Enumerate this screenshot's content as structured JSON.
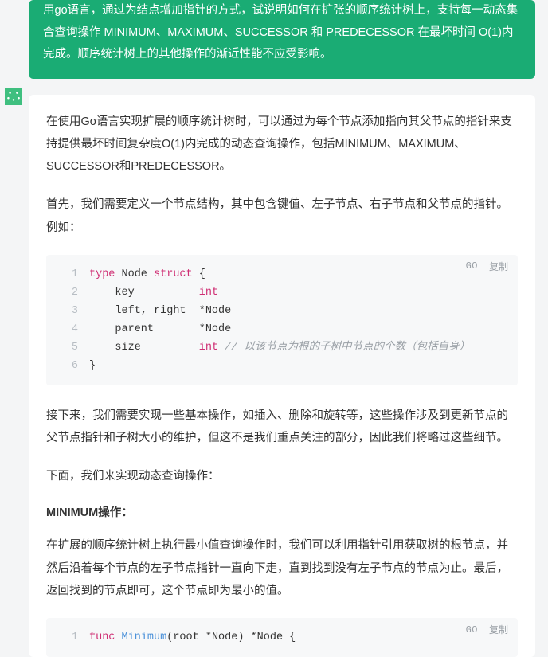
{
  "prompt": {
    "text": "用go语言，通过为结点增加指针的方式，试说明如何在扩张的顺序统计树上，支持每一动态集合查询操作 MINIMUM、MAXIMUM、SUCCESSOR 和 PREDECESSOR 在最坏时间 O(1)内完成。顺序统计树上的其他操作的渐近性能不应受影响。"
  },
  "avatar": {
    "name": "assistant-avatar"
  },
  "paras": {
    "p1": "在使用Go语言实现扩展的顺序统计树时，可以通过为每个节点添加指向其父节点的指针来支持提供最坏时间复杂度O(1)内完成的动态查询操作，包括MINIMUM、MAXIMUM、SUCCESSOR和PREDECESSOR。",
    "p2": "首先，我们需要定义一个节点结构，其中包含键值、左子节点、右子节点和父节点的指针。例如：",
    "p3": "接下来，我们需要实现一些基本操作，如插入、删除和旋转等，这些操作涉及到更新节点的父节点指针和子树大小的维护，但这不是我们重点关注的部分，因此我们将略过这些细节。",
    "p4": "下面，我们来实现动态查询操作：",
    "p5": "在扩展的顺序统计树上执行最小值查询操作时，我们可以利用指针引用获取树的根节点，并然后沿着每个节点的左子节点指针一直向下走，直到找到没有左子节点的节点为止。最后，返回找到的节点即可，这个节点即为最小的值。"
  },
  "heading1": "MINIMUM操作：",
  "codeA": {
    "lang": "GO",
    "copy": "复制",
    "lines": {
      "n1": "1",
      "n2": "2",
      "n3": "3",
      "n4": "4",
      "n5": "5",
      "n6": "6",
      "t1a": "type",
      "t1b": " Node ",
      "t1c": "struct",
      "t1d": " {",
      "t2a": "    key          ",
      "t2b": "int",
      "t3": "    left, right  *Node",
      "t4": "    parent       *Node",
      "t5a": "    size         ",
      "t5b": "int",
      "t5c": " ",
      "t5d": "// 以该节点为根的子树中节点的个数（包括自身）",
      "t6": "}"
    }
  },
  "codeB": {
    "lang": "GO",
    "copy": "复制",
    "lines": {
      "n1": "1",
      "t1a": "func",
      "t1b": " ",
      "t1c": "Minimum",
      "t1d": "(root *Node) *Node {"
    }
  }
}
